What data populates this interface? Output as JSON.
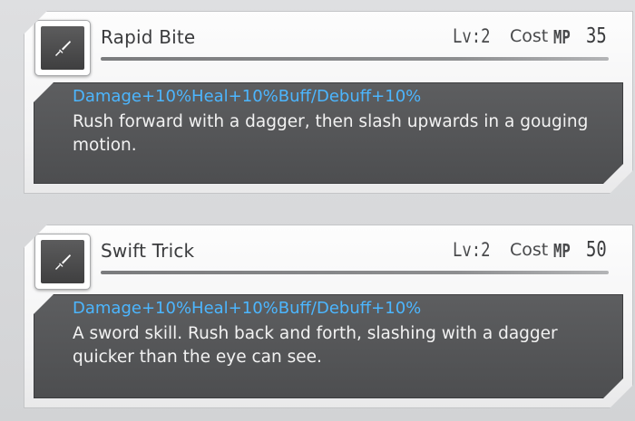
{
  "skills": [
    {
      "icon": "dagger-icon",
      "name": "Rapid Bite",
      "level": "Lv:2",
      "cost_label": "Cost",
      "cost_unit": "MP",
      "cost_value": "35",
      "effects": "Damage+10%Heal+10%Buff/Debuff+10%",
      "description": "Rush forward with a dagger, then slash upwards in a gouging motion."
    },
    {
      "icon": "dagger-icon",
      "name": "Swift Trick",
      "level": "Lv:2",
      "cost_label": "Cost",
      "cost_unit": "MP",
      "cost_value": "50",
      "effects": "Damage+10%Heal+10%Buff/Debuff+10%",
      "description": "A sword skill. Rush back and forth, slashing with a dagger quicker than the eye can see."
    }
  ],
  "colors": {
    "effect_text": "#4cb6ff",
    "description_text": "#f2f2f2",
    "panel_background": "#555658"
  }
}
